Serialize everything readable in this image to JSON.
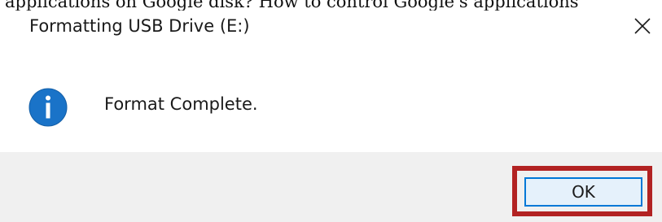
{
  "page_caption": "applications on Google disk? How to control Google's applications",
  "dialog": {
    "title": "Formatting USB Drive (E:)",
    "close_icon": "close-icon",
    "info_icon": "info-icon",
    "message": "Format Complete.",
    "ok_label": "OK"
  },
  "colors": {
    "info_icon_blue": "#1a73c8",
    "ok_button_border": "#0078d7",
    "highlight_box": "#b22222",
    "footer_background": "#f0f0f0"
  }
}
